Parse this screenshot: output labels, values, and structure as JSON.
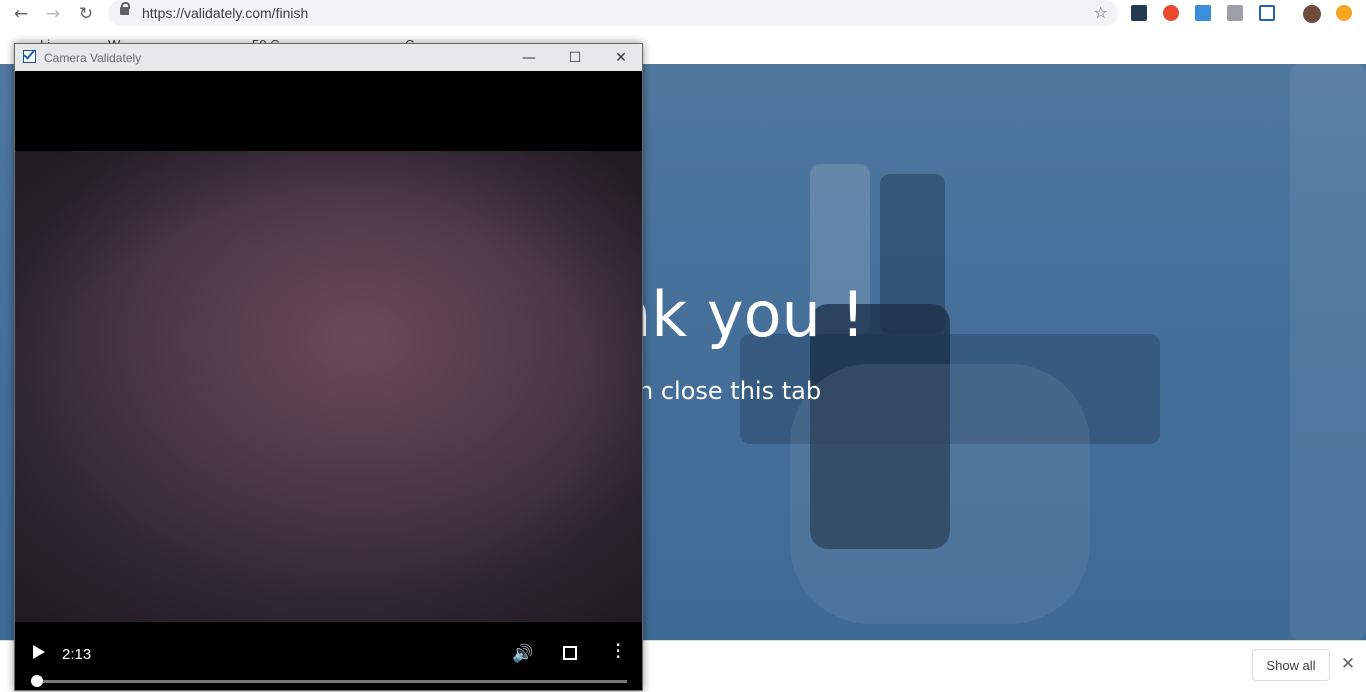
{
  "browser": {
    "url": "https://validately.com/finish",
    "bookmarks": [
      "Li...",
      "W...",
      "50 C...",
      "C..."
    ],
    "extensions": [
      "extension-1-icon",
      "extension-2-icon",
      "download-icon",
      "camera-icon",
      "validately-icon",
      "profile-icon",
      "update-icon"
    ]
  },
  "page": {
    "title": "nk you !",
    "subtitle": "n close this tab"
  },
  "downloads": {
    "show_all": "Show all"
  },
  "popup": {
    "title": "Camera Validately",
    "player": {
      "time": "2:13"
    }
  }
}
